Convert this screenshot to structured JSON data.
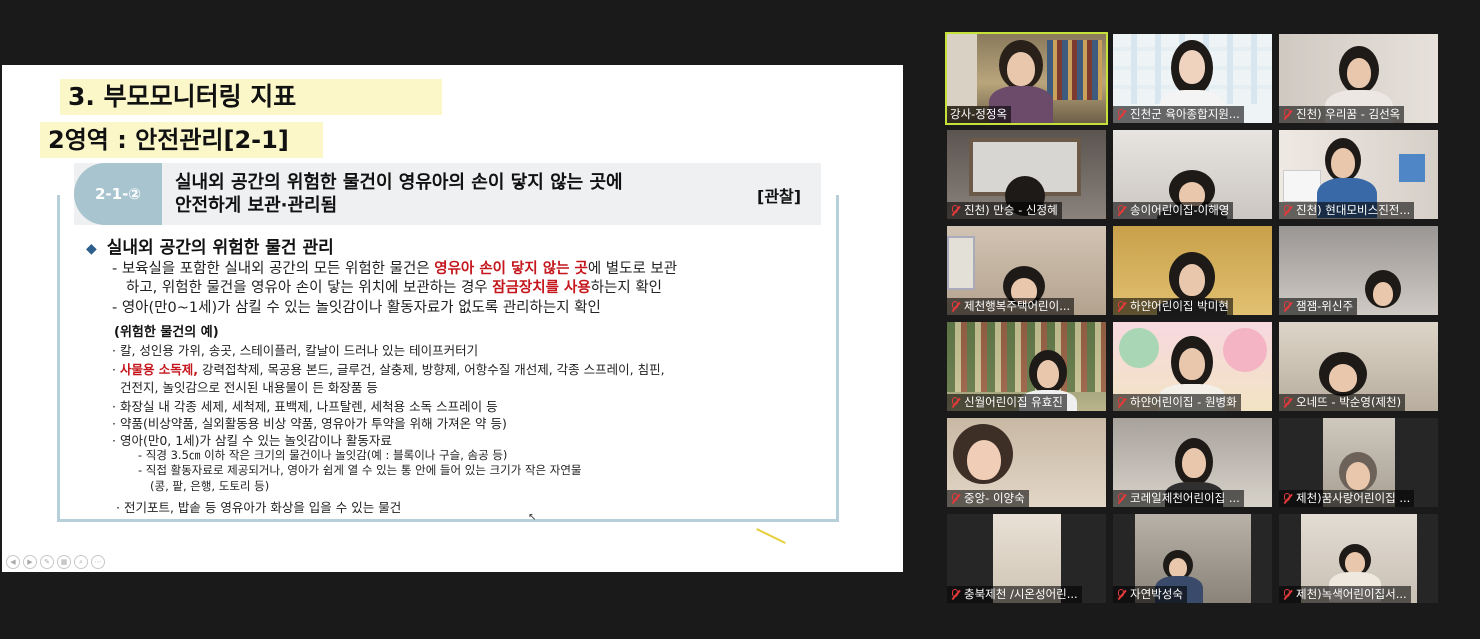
{
  "slide": {
    "title": "3. 부모모니터링 지표",
    "section": "2영역 : 안전관리[2-1]",
    "indicator": {
      "code": "2-1-②",
      "text_line1": "실내외 공간의 위험한 물건이 영유아의 손이 닿지 않는 곳에",
      "text_line2": "안전하게 보관·관리됨",
      "tag": "[관찰]"
    },
    "heading": "실내외 공간의 위험한 물건 관리",
    "body": {
      "l1_a": "- 보육실을 포함한 실내외 공간의 모든 위험한 물건은 ",
      "l1_red": "영유아 손이 닿지 않는 곳",
      "l1_b": "에 별도로 보관",
      "l2_a": "하고, 위험한 물건을 영유아 손이 닿는 위치에 보관하는 경우 ",
      "l2_red": "잠금장치를 사용",
      "l2_b": "하는지 확인",
      "l3": "- 영아(만0~1세)가 삼킬 수 있는 놀잇감이나 활동자료가 없도록 관리하는지 확인"
    },
    "examples_heading": "(위험한 물건의 예)",
    "examples": {
      "e1": "· 칼, 성인용 가위, 송곳, 스테이플러, 칼날이 드러나 있는 테이프커터기",
      "e2_prefix": "· ",
      "e2_red": "사물용 소독제,",
      "e2_rest": " 강력접착제, 목공용 본드, 글루건, 살충제, 방향제, 어항수질 개선제, 각종 스프레이, 침핀,",
      "e3": "건전지, 놀잇감으로 전시된 내용물이 든 화장품 등",
      "e4": "· 화장실 내 각종 세제, 세척제, 표백제, 나프탈렌, 세척용 소독 스프레이 등",
      "e5": "· 약품(비상약품, 실외활동용 비상 약품, 영유아가 투약을 위해 가져온 약 등)",
      "e6": "· 영아(만0, 1세)가 삼킬 수 있는 놀잇감이나 활동자료",
      "s1": "- 직경 3.5㎝ 이하 작은 크기의 물건이나 놀잇감(예 : 블록이나 구슬, 솜공 등)",
      "s2": "- 직접 활동자료로 제공되거나, 영아가 쉽게 열 수 있는 통 안에 들어 있는 크기가 작은 자연물",
      "s3": "(콩, 팥, 은행, 도토리 등)",
      "e7": "· 전기포트, 밥솥 등 영유아가 화상을 입을 수 있는 물건"
    }
  },
  "participants": [
    {
      "name": "강사-정정옥",
      "muted": false,
      "active": true
    },
    {
      "name": "진천군 육아종합지원...",
      "muted": true
    },
    {
      "name": "진천) 우리꿈 - 김선옥",
      "muted": true
    },
    {
      "name": "진천) 만승 - 신정혜",
      "muted": true
    },
    {
      "name": "송이어린이집-이해영",
      "muted": true
    },
    {
      "name": "진천) 현대모비스진전...",
      "muted": true
    },
    {
      "name": "제천행복주택어린이...",
      "muted": true
    },
    {
      "name": "하얀어린이집 박미현",
      "muted": true
    },
    {
      "name": "잼잼-위신주",
      "muted": true
    },
    {
      "name": "신월어린이집 유효진",
      "muted": true
    },
    {
      "name": "하얀어린이집 - 원병화",
      "muted": true
    },
    {
      "name": "오네뜨 - 박순영(제천)",
      "muted": true
    },
    {
      "name": "중앙- 이양숙",
      "muted": true
    },
    {
      "name": "코레일제천어린이집 ...",
      "muted": true
    },
    {
      "name": "제천)꿈사랑어린이집 ...",
      "muted": true
    },
    {
      "name": "충북제천 /시온성어린...",
      "muted": true
    },
    {
      "name": "자연박성숙",
      "muted": true
    },
    {
      "name": "제천)녹색어린이집서...",
      "muted": true
    }
  ],
  "colors": {
    "active_speaker": "#c6e23a",
    "highlight": "#c4161c",
    "indicator_pill": "#a8c4cf",
    "muted_icon": "#e23a3a"
  }
}
